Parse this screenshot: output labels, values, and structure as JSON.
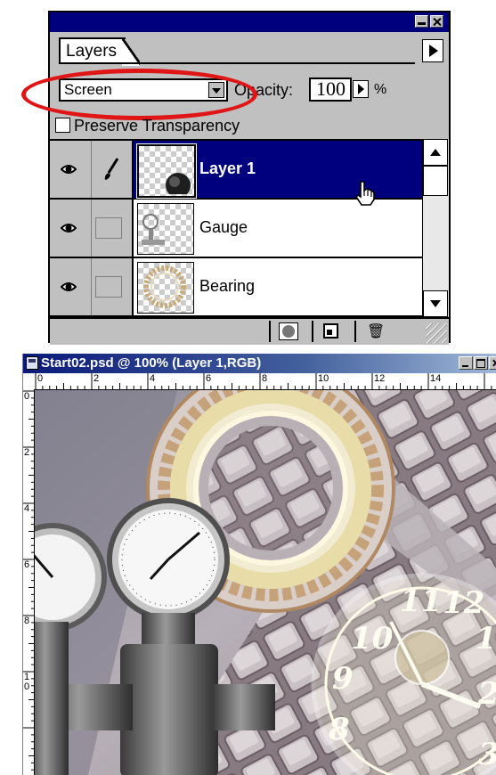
{
  "layers_palette": {
    "tab_label": "Layers",
    "blend_mode": "Screen",
    "opacity_label": "Opacity:",
    "opacity_value": "100",
    "opacity_unit": "%",
    "preserve_label": "Preserve Transparency",
    "layers": [
      {
        "name": "Layer 1",
        "selected": true,
        "visible": true,
        "brush": true
      },
      {
        "name": "Gauge",
        "selected": false,
        "visible": true,
        "brush": false
      },
      {
        "name": "Bearing",
        "selected": false,
        "visible": true,
        "brush": false
      },
      {
        "name": "",
        "selected": false,
        "visible": true,
        "brush": false
      }
    ],
    "icons": [
      "eye-icon",
      "brush-icon",
      "mask-icon",
      "new-layer-icon",
      "trash-icon",
      "hand-cursor-icon"
    ]
  },
  "document_window": {
    "title": "Start02.psd @ 100% (Layer 1,RGB)",
    "h_ruler_labels": [
      "0",
      "2",
      "4",
      "6",
      "8",
      "10",
      "12",
      "14"
    ],
    "v_ruler_labels": [
      "0",
      "2",
      "4",
      "6",
      "8",
      "1\n0"
    ]
  },
  "colors": {
    "selection": "#00007e",
    "highlight_oval": "#e01616",
    "palette_gray": "#c0c0c0"
  }
}
